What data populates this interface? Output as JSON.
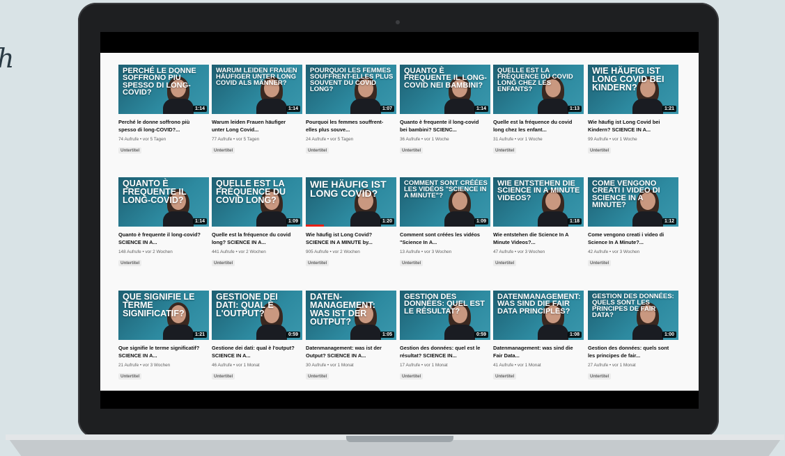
{
  "side_text": "h",
  "videos": [
    {
      "thumb": "PERCHÉ LE DONNE SOFFRONO PIÙ SPESSO DI LONG-COVID?",
      "duration": "1:14",
      "title": "Perché le donne soffrono più spesso di long-COVID?...",
      "meta": "74 Aufrufe • vor 5 Tagen",
      "badge": "Untertitel"
    },
    {
      "thumb": "WARUM LEIDEN FRAUEN HÄUFIGER UNTER LONG COVID ALS MÄNNER?",
      "duration": "1:14",
      "title": "Warum leiden Frauen häufiger unter Long Covid...",
      "meta": "77 Aufrufe • vor 5 Tagen",
      "badge": "Untertitel"
    },
    {
      "thumb": "POURQUOI LES FEMMES SOUFFRENT-ELLES PLUS SOUVENT DU COVID LONG?",
      "duration": "1:07",
      "title": "Pourquoi les femmes souffrent-elles plus souve...",
      "meta": "24 Aufrufe • vor 5 Tagen",
      "badge": "Untertitel"
    },
    {
      "thumb": "QUANTO È FREQUENTE IL LONG-COVID NEI BAMBINI?",
      "duration": "1:14",
      "title": "Quanto è frequente il long-covid bei bambini? SCIENC...",
      "meta": "36 Aufrufe • vor 1 Woche",
      "badge": "Untertitel"
    },
    {
      "thumb": "QUELLE EST LA FRÉQUENCE DU COVID LONG CHEZ LES ENFANTS?",
      "duration": "1:13",
      "title": "Quelle est la fréquence du covid long chez les enfant...",
      "meta": "31 Aufrufe • vor 1 Woche",
      "badge": "Untertitel"
    },
    {
      "thumb": "WIE HÄUFIG IST LONG COVID BEI KINDERN?",
      "duration": "1:21",
      "title": "Wie häufig ist Long Covid bei Kindern? SCIENCE IN A...",
      "meta": "99 Aufrufe • vor 1 Woche",
      "badge": "Untertitel"
    },
    {
      "thumb": "QUANTO È FREQUENTE IL LONG-COVID?",
      "duration": "1:14",
      "title": "Quanto è frequente il long-covid? SCIENCE IN A...",
      "meta": "148 Aufrufe • vor 2 Wochen",
      "badge": "Untertitel"
    },
    {
      "thumb": "QUELLE EST LA FRÉQUENCE DU COVID LONG?",
      "duration": "1:09",
      "title": "Quelle est la fréquence du covid long? SCIENCE IN A...",
      "meta": "441 Aufrufe • vor 2 Wochen",
      "badge": "Untertitel"
    },
    {
      "thumb": "WIE HÄUFIG IST LONG COVID?",
      "duration": "1:20",
      "title": "Wie häufig ist Long Covid? SCIENCE IN A MINUTE by...",
      "meta": "905 Aufrufe • vor 2 Wochen",
      "badge": "Untertitel",
      "progress": 0.2
    },
    {
      "thumb": "COMMENT SONT CRÉÉES LES VIDÉOS \"SCIENCE IN A MINUTE\"?",
      "duration": "1:09",
      "title": "Comment sont créées les vidéos \"Science In A...",
      "meta": "13 Aufrufe • vor 3 Wochen",
      "badge": "Untertitel"
    },
    {
      "thumb": "WIE ENTSTEHEN DIE SCIENCE IN A MINUTE VIDEOS?",
      "duration": "1:18",
      "title": "Wie entstehen die Science In A Minute Videos?...",
      "meta": "47 Aufrufe • vor 3 Wochen",
      "badge": "Untertitel"
    },
    {
      "thumb": "COME VENGONO CREATI I VIDEO DI SCIENCE IN A MINUTE?",
      "duration": "1:12",
      "title": "Come vengono creati i video di Science In A Minute?...",
      "meta": "42 Aufrufe • vor 3 Wochen",
      "badge": "Untertitel"
    },
    {
      "thumb": "QUE SIGNIFIE LE TERME SIGNIFICATIF?",
      "duration": "1:21",
      "title": "Que signifie le terme significatif? SCIENCE IN A...",
      "meta": "21 Aufrufe • vor 3 Wochen",
      "badge": "Untertitel"
    },
    {
      "thumb": "GESTIONE DEI DATI: QUAL È L'OUTPUT?",
      "duration": "0:59",
      "title": "Gestione dei dati: qual è l'output? SCIENCE IN A...",
      "meta": "46 Aufrufe • vor 1 Monat",
      "badge": "Untertitel"
    },
    {
      "thumb": "DATEN-MANAGEMENT: WAS IST DER OUTPUT?",
      "duration": "1:05",
      "title": "Datenmanagement: was ist der Output? SCIENCE IN A...",
      "meta": "30 Aufrufe • vor 1 Monat",
      "badge": "Untertitel"
    },
    {
      "thumb": "GESTION DES DONNÉES: QUEL EST LE RÉSULTAT?",
      "duration": "0:59",
      "title": "Gestion des données: quel est le résultat? SCIENCE IN...",
      "meta": "17 Aufrufe • vor 1 Monat",
      "badge": "Untertitel"
    },
    {
      "thumb": "DATENMANAGEMENT: WAS SIND DIE FAIR DATA PRINCIPLES?",
      "duration": "1:08",
      "title": "Datenmanagement: was sind die Fair Data...",
      "meta": "41 Aufrufe • vor 1 Monat",
      "badge": "Untertitel"
    },
    {
      "thumb": "GESTION DES DONNÉES: QUELS SONT LES PRINCIPES DE FAIR DATA?",
      "duration": "1:00",
      "title": "Gestion des données: quels sont les principes de fair...",
      "meta": "27 Aufrufe • vor 1 Monat",
      "badge": "Untertitel"
    }
  ]
}
